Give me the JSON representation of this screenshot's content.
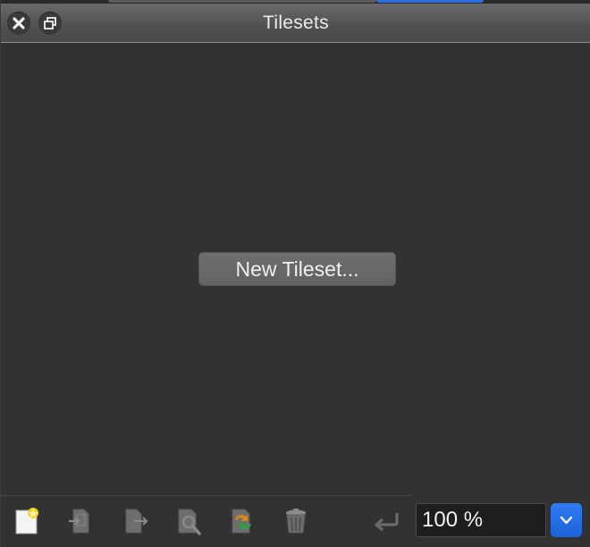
{
  "panel": {
    "title": "Tilesets"
  },
  "content": {
    "new_tileset_label": "New Tileset..."
  },
  "toolbar": {
    "items": [
      {
        "name": "new-tileset-icon"
      },
      {
        "name": "import-tileset-icon"
      },
      {
        "name": "export-tileset-icon"
      },
      {
        "name": "find-tileset-icon"
      },
      {
        "name": "replace-tileset-icon"
      },
      {
        "name": "delete-tileset-icon"
      }
    ]
  },
  "zoom": {
    "value": "100 %"
  },
  "colors": {
    "background": "#323232",
    "accent": "#1f6fe5",
    "titlebar": "#555555"
  }
}
